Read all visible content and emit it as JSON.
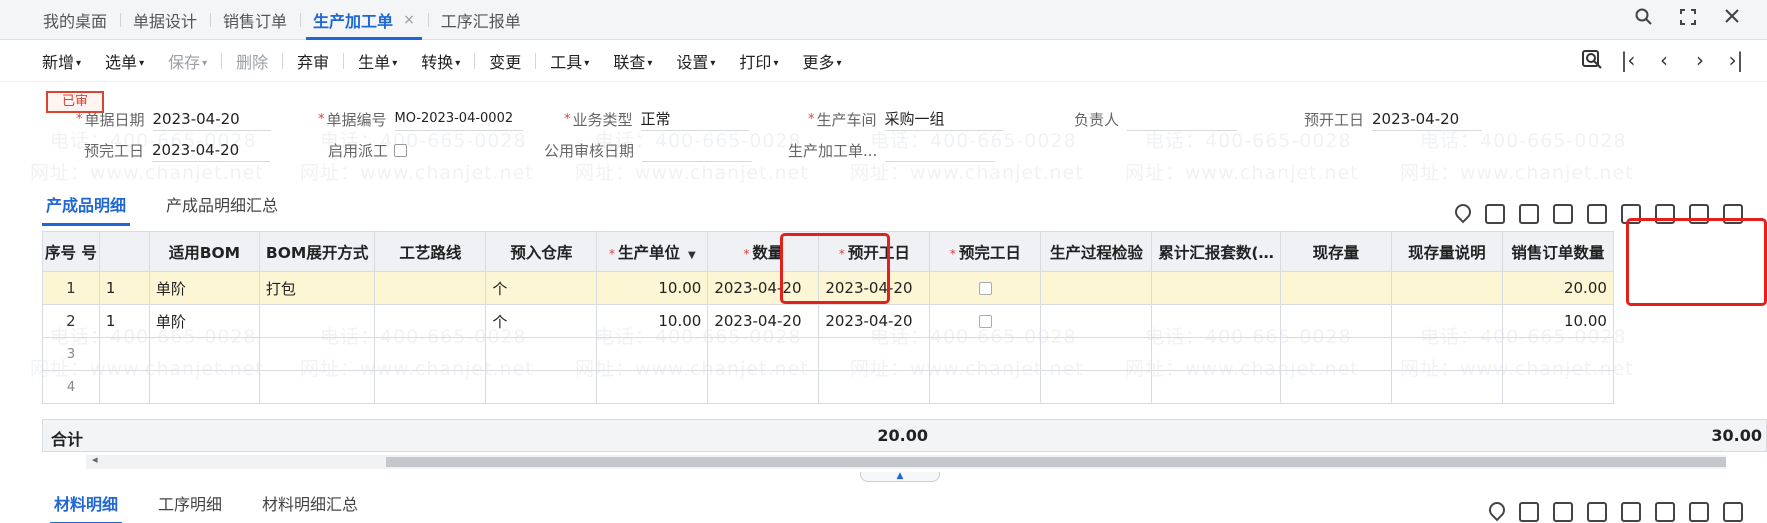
{
  "tabs": [
    {
      "label": "我的桌面"
    },
    {
      "label": "单据设计"
    },
    {
      "label": "销售订单"
    },
    {
      "label": "生产加工单",
      "active": true
    },
    {
      "label": "工序汇报单"
    }
  ],
  "tab_close": "×",
  "toolbar": {
    "new": "新增",
    "select": "选单",
    "save": "保存",
    "delete": "删除",
    "abandon": "弃审",
    "generate": "生单",
    "convert": "转换",
    "change": "变更",
    "tools": "工具",
    "query": "联查",
    "settings": "设置",
    "print": "打印",
    "more": "更多"
  },
  "status": "已审",
  "form": {
    "doc_date_label": "单据日期",
    "doc_date": "2023-04-20",
    "doc_no_label": "单据编号",
    "doc_no": "MO-2023-04-0002",
    "biz_type_label": "业务类型",
    "biz_type": "正常",
    "workshop_label": "生产车间",
    "workshop": "采购一组",
    "owner_label": "负责人",
    "owner": "",
    "plan_start_label": "预开工日",
    "plan_start": "2023-04-20",
    "plan_finish_label": "预完工日",
    "plan_finish": "2023-04-20",
    "dispatch_label": "启用派工",
    "audit_date_label": "公用审核日期",
    "audit_date": "",
    "doc_ref_label": "生产加工单...",
    "doc_ref": ""
  },
  "subtabs": [
    "产成品明细",
    "产成品明细汇总"
  ],
  "grid": {
    "headers": [
      "序号 号",
      "",
      "适用BOM",
      "BOM展开方式",
      "工艺路线",
      "预入仓库",
      "生产单位",
      "数量",
      "预开工日",
      "预完工日",
      "生产过程检验",
      "累计汇报套数(…",
      "现存量",
      "现存量说明",
      "销售订单数量"
    ],
    "rows": [
      {
        "no": "1",
        "bom": "1",
        "expand": "单阶",
        "route": "打包",
        "warehouse": "",
        "unit": "个",
        "qty": "10.00",
        "start": "2023-04-20",
        "finish": "2023-04-20",
        "reported": "",
        "stock": "",
        "stock_note": "",
        "so_qty": "20.00"
      },
      {
        "no": "2",
        "bom": "1",
        "expand": "单阶",
        "route": "",
        "warehouse": "",
        "unit": "个",
        "qty": "10.00",
        "start": "2023-04-20",
        "finish": "2023-04-20",
        "reported": "",
        "stock": "",
        "stock_note": "",
        "so_qty": "10.00"
      },
      {
        "no": "3"
      },
      {
        "no": "4"
      }
    ]
  },
  "totals": {
    "label": "合计",
    "qty": "20.00",
    "so_qty": "30.00"
  },
  "subtabs_bottom": [
    "材料明细",
    "工序明细",
    "材料明细汇总"
  ],
  "watermark": {
    "phone": "电话：400-665-0028",
    "site": "网址：www.chanjet.net"
  },
  "colors": {
    "accent": "#1f67d2",
    "highlight": "#e4201d",
    "selected_row": "#fdf6d5"
  }
}
